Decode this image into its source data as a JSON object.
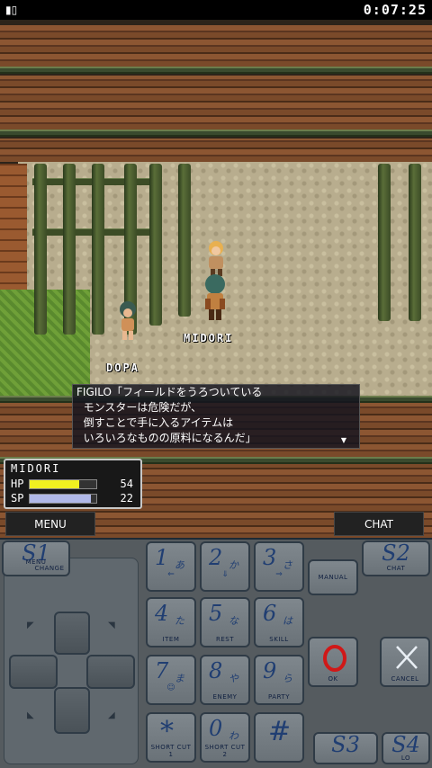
{
  "statusbar": {
    "signal_icon": "signal-icon",
    "clock": "0:07:25"
  },
  "characters": {
    "player": "MIDORI",
    "npc": "DOPA"
  },
  "dialog": {
    "line1": "FIGILO「フィールドをうろついている",
    "line2": "  モンスターは危険だが、",
    "line3": "  倒すことで手に入るアイテムは",
    "line4": "  いろいろなものの原料になるんだ」"
  },
  "status": {
    "name": "MIDORI",
    "hp_label": "HP",
    "hp_value": "54",
    "hp_fill": 0.74,
    "sp_label": "SP",
    "sp_value": "22",
    "sp_fill": 0.92,
    "hp_color": "#f0f020",
    "sp_color": "#b0b8e8"
  },
  "softkeys": {
    "left": "MENU",
    "right": "CHAT"
  },
  "keypad": {
    "s1": {
      "label": "S1",
      "sub1": "MENU",
      "sub2": "CHANGE"
    },
    "s2": {
      "label": "S2",
      "sub": "CHAT"
    },
    "s3": {
      "label": "S3"
    },
    "s4": {
      "label": "S4",
      "sub": "LO"
    },
    "manual": "MANUAL",
    "ok": "OK",
    "cancel": "CANCEL",
    "keys": [
      {
        "num": "1",
        "kana": "あ",
        "sub": ""
      },
      {
        "num": "2",
        "kana": "か",
        "sub": ""
      },
      {
        "num": "3",
        "kana": "さ",
        "sub": ""
      },
      {
        "num": "4",
        "kana": "た",
        "sub": "ITEM"
      },
      {
        "num": "5",
        "kana": "な",
        "sub": "REST"
      },
      {
        "num": "6",
        "kana": "は",
        "sub": "SKILL"
      },
      {
        "num": "7",
        "kana": "ま",
        "sub": ""
      },
      {
        "num": "8",
        "kana": "や",
        "sub": "ENEMY"
      },
      {
        "num": "9",
        "kana": "ら",
        "sub": "PARTY"
      },
      {
        "num": "*",
        "kana": "",
        "sub": "SHORT CUT 1"
      },
      {
        "num": "0",
        "kana": "わ",
        "sub": "SHORT CUT 2"
      },
      {
        "num": "#",
        "kana": "",
        "sub": ""
      }
    ]
  }
}
